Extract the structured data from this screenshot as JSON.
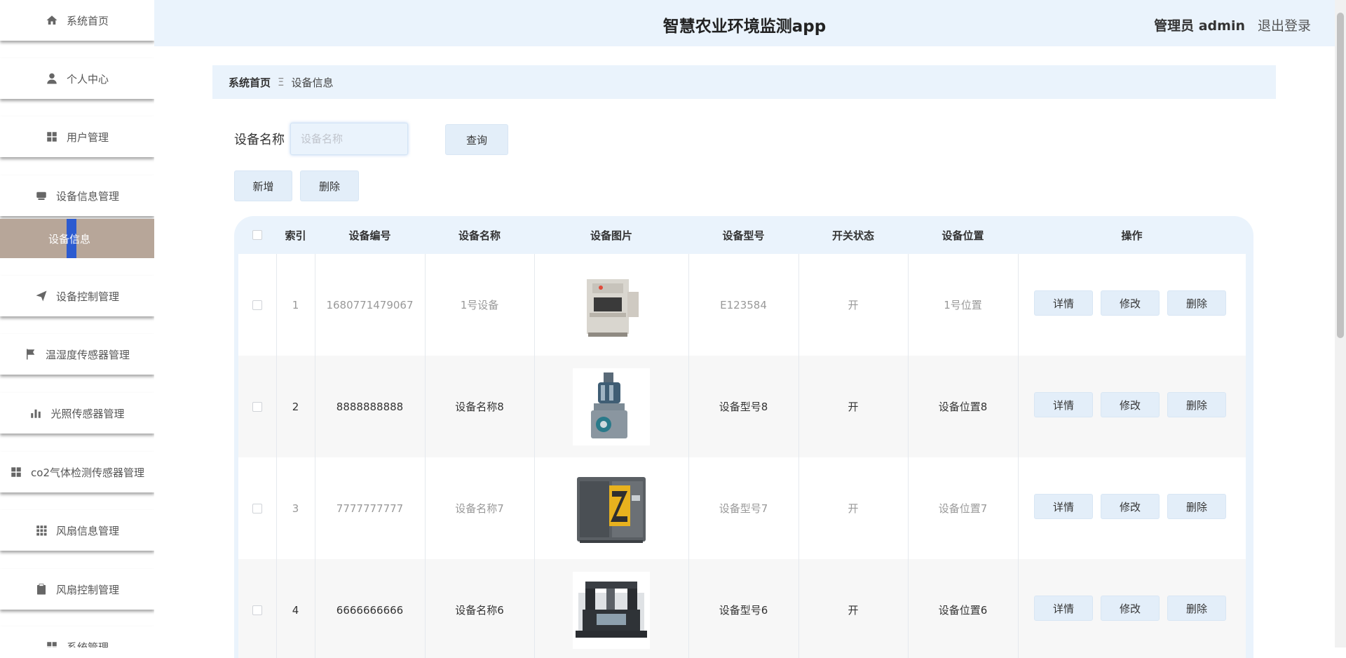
{
  "app": {
    "title": "智慧农业环境监测app",
    "admin_label": "管理员 admin",
    "logout_label": "退出登录"
  },
  "sidebar": {
    "items": [
      {
        "label": "系统首页",
        "icon": "home-icon"
      },
      {
        "label": "个人中心",
        "icon": "user-icon"
      },
      {
        "label": "用户管理",
        "icon": "grid-icon"
      },
      {
        "label": "设备信息管理",
        "icon": "device-icon"
      },
      {
        "label": "设备控制管理",
        "icon": "send-icon"
      },
      {
        "label": "温湿度传感器管理",
        "icon": "flag-icon"
      },
      {
        "label": "光照传感器管理",
        "icon": "bar-chart-icon"
      },
      {
        "label": "co2气体检测传感器管理",
        "icon": "grid-icon"
      },
      {
        "label": "风扇信息管理",
        "icon": "grid-small-icon"
      },
      {
        "label": "风扇控制管理",
        "icon": "clipboard-icon"
      },
      {
        "label": "系统管理",
        "icon": "grid-icon"
      }
    ],
    "active_sub": {
      "label": "设备信息"
    }
  },
  "breadcrumb": {
    "home": "系统首页",
    "separator": "Ξ",
    "current": "设备信息"
  },
  "search": {
    "label": "设备名称",
    "placeholder": "设备名称",
    "value": "",
    "query_button": "查询"
  },
  "actions": {
    "add": "新增",
    "delete": "删除"
  },
  "table": {
    "headers": {
      "index": "索引",
      "code": "设备编号",
      "name": "设备名称",
      "image": "设备图片",
      "model": "设备型号",
      "switch": "开关状态",
      "location": "设备位置",
      "ops": "操作"
    },
    "rows": [
      {
        "index": "1",
        "code": "1680771479067",
        "name": "1号设备",
        "image": "press-machine",
        "model": "E123584",
        "switch": "开",
        "location": "1号位置"
      },
      {
        "index": "2",
        "code": "8888888888",
        "name": "设备名称8",
        "image": "rotary-machine",
        "model": "设备型号8",
        "switch": "开",
        "location": "设备位置8"
      },
      {
        "index": "3",
        "code": "7777777777",
        "name": "设备名称7",
        "image": "compressor-cabinet",
        "model": "设备型号7",
        "switch": "开",
        "location": "设备位置7"
      },
      {
        "index": "4",
        "code": "6666666666",
        "name": "设备名称6",
        "image": "gantry-machine",
        "model": "设备型号6",
        "switch": "开",
        "location": "设备位置6"
      }
    ],
    "row_buttons": {
      "detail": "详情",
      "edit": "修改",
      "delete": "删除"
    }
  },
  "colors": {
    "accent_bg": "#eaf3fc",
    "active_menu": "#b7a699",
    "active_marker": "#2c5bd0"
  }
}
